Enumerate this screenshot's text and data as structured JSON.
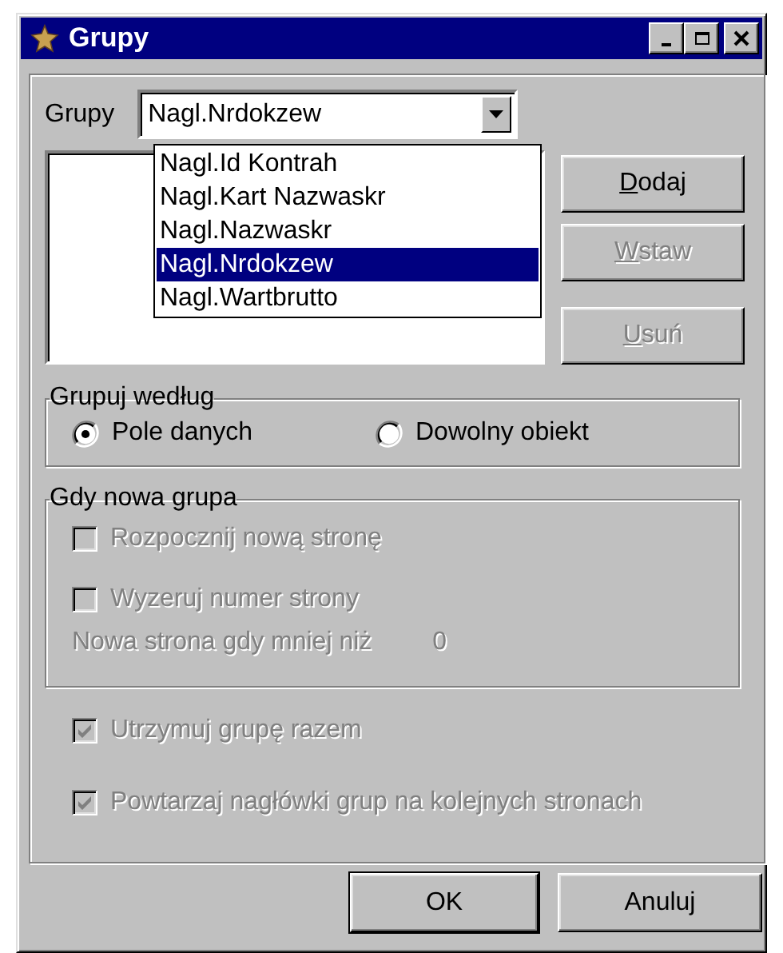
{
  "window": {
    "title": "Grupy",
    "controls": [
      {
        "kind": "minimize"
      },
      {
        "kind": "maximize"
      },
      {
        "kind": "close"
      }
    ]
  },
  "groups_combo": {
    "label": "Grupy",
    "value": "Nagl.Nrdokzew",
    "expanded": true,
    "options": [
      {
        "label": "Nagl.Id Kontrah",
        "selected": false
      },
      {
        "label": "Nagl.Kart Nazwaskr",
        "selected": false
      },
      {
        "label": "Nagl.Nazwaskr",
        "selected": false
      },
      {
        "label": "Nagl.Nrdokzew",
        "selected": true
      },
      {
        "label": "Nagl.Wartbrutto",
        "selected": false
      }
    ]
  },
  "side_buttons": [
    {
      "label": "Dodaj",
      "disabled": false,
      "mnemonic": true
    },
    {
      "label": "Wstaw",
      "disabled": true,
      "mnemonic": true
    },
    {
      "label": "Usuń",
      "disabled": true,
      "mnemonic": true
    }
  ],
  "group_by": {
    "title": "Grupuj według",
    "options": [
      {
        "label": "Pole danych",
        "selected": true
      },
      {
        "label": "Dowolny obiekt",
        "selected": false
      }
    ]
  },
  "new_group": {
    "title": "Gdy nowa grupa",
    "options": [
      {
        "label": "Rozpocznij nową stronę",
        "checked": false,
        "disabled": true
      },
      {
        "label": "Wyzeruj numer strony",
        "checked": false,
        "disabled": true
      }
    ],
    "threshold": {
      "label": "Nowa strona gdy mniej niż",
      "value": "0",
      "disabled": true
    }
  },
  "options": [
    {
      "label": "Utrzymuj grupę razem",
      "checked": true,
      "disabled": true
    },
    {
      "label": "Powtarzaj nagłówki grup na kolejnych stronach",
      "checked": true,
      "disabled": true
    }
  ],
  "footer_buttons": [
    {
      "label": "OK",
      "default": true,
      "mnemonic": false
    },
    {
      "label": "Anuluj",
      "default": false,
      "mnemonic": false
    }
  ]
}
